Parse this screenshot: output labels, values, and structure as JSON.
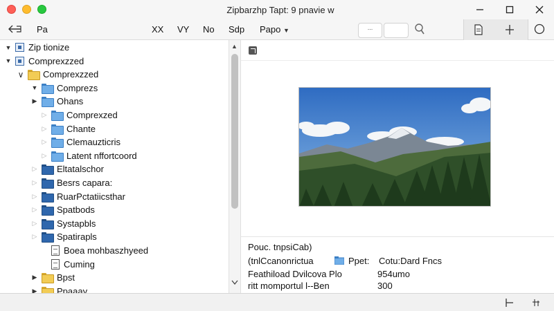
{
  "window": {
    "title": "Zipbarzhp Tapt: 9 pnavie w"
  },
  "toolbar": {
    "back_label": "Pa",
    "items": [
      "XX",
      "VY",
      "No",
      "Sdp"
    ],
    "menu_label": "Papo",
    "search_text": "..."
  },
  "tree": {
    "rows": [
      {
        "label": "Zip tionize",
        "depth": 0,
        "disc": "open",
        "icon": "zip"
      },
      {
        "label": "Comprexzzed",
        "depth": 0,
        "disc": "open",
        "icon": "zip"
      },
      {
        "label": "Comprexzzed",
        "depth": 1,
        "disc": "open-outline",
        "icon": "folder-yellow"
      },
      {
        "label": "Comprezs",
        "depth": 2,
        "disc": "open",
        "icon": "folder-blue"
      },
      {
        "label": "Ohans",
        "depth": 2,
        "disc": "closed",
        "icon": "folder-blue"
      },
      {
        "label": "Comprexzed",
        "depth": 3,
        "disc": "closed-outline",
        "icon": "folder-blue"
      },
      {
        "label": "Chante",
        "depth": 3,
        "disc": "closed-outline",
        "icon": "folder-blue"
      },
      {
        "label": "Clemauzticris",
        "depth": 3,
        "disc": "closed-outline",
        "icon": "folder-blue"
      },
      {
        "label": "Latent nffortcoord",
        "depth": 3,
        "disc": "closed-outline",
        "icon": "folder-blue"
      },
      {
        "label": "Eltatalschor",
        "depth": 2,
        "disc": "closed-outline",
        "icon": "folder-dark"
      },
      {
        "label": "Besrs capara:",
        "depth": 2,
        "disc": "closed-outline",
        "icon": "folder-dark"
      },
      {
        "label": "RuarPctatiicsthar",
        "depth": 2,
        "disc": "closed-outline",
        "icon": "folder-dark"
      },
      {
        "label": "Spatbods",
        "depth": 2,
        "disc": "closed-outline",
        "icon": "folder-dark"
      },
      {
        "label": "Systapbls",
        "depth": 2,
        "disc": "closed-outline",
        "icon": "folder-dark"
      },
      {
        "label": "Spatirapls",
        "depth": 2,
        "disc": "closed-outline",
        "icon": "folder-dark"
      },
      {
        "label": "Boea mohbaszhyeed",
        "depth": 3,
        "disc": "none",
        "icon": "doc"
      },
      {
        "label": "Cuming",
        "depth": 3,
        "disc": "none",
        "icon": "doc"
      },
      {
        "label": "Bpst",
        "depth": 2,
        "disc": "closed",
        "icon": "folder-yellow"
      },
      {
        "label": "Ppaaay",
        "depth": 2,
        "disc": "closed",
        "icon": "folder-yellow"
      }
    ]
  },
  "preview": {
    "caption": "Pouc. tnpsiCab)",
    "rows": [
      {
        "key": "(tnlCcanonrictua",
        "value": "Ppet:",
        "extra": "Cotu:Dard Fncs"
      },
      {
        "key": "Feathiload Dvilcova Plo",
        "value": "954umo"
      },
      {
        "key": "ritt momportul l--Ben",
        "value": "300"
      }
    ]
  },
  "colors": {
    "accent_blue": "#3b7fc5",
    "folder_yellow": "#f2cc55",
    "close_red": "#fe5f57",
    "minimize_yellow": "#febc2e",
    "zoom_green": "#28c840"
  }
}
